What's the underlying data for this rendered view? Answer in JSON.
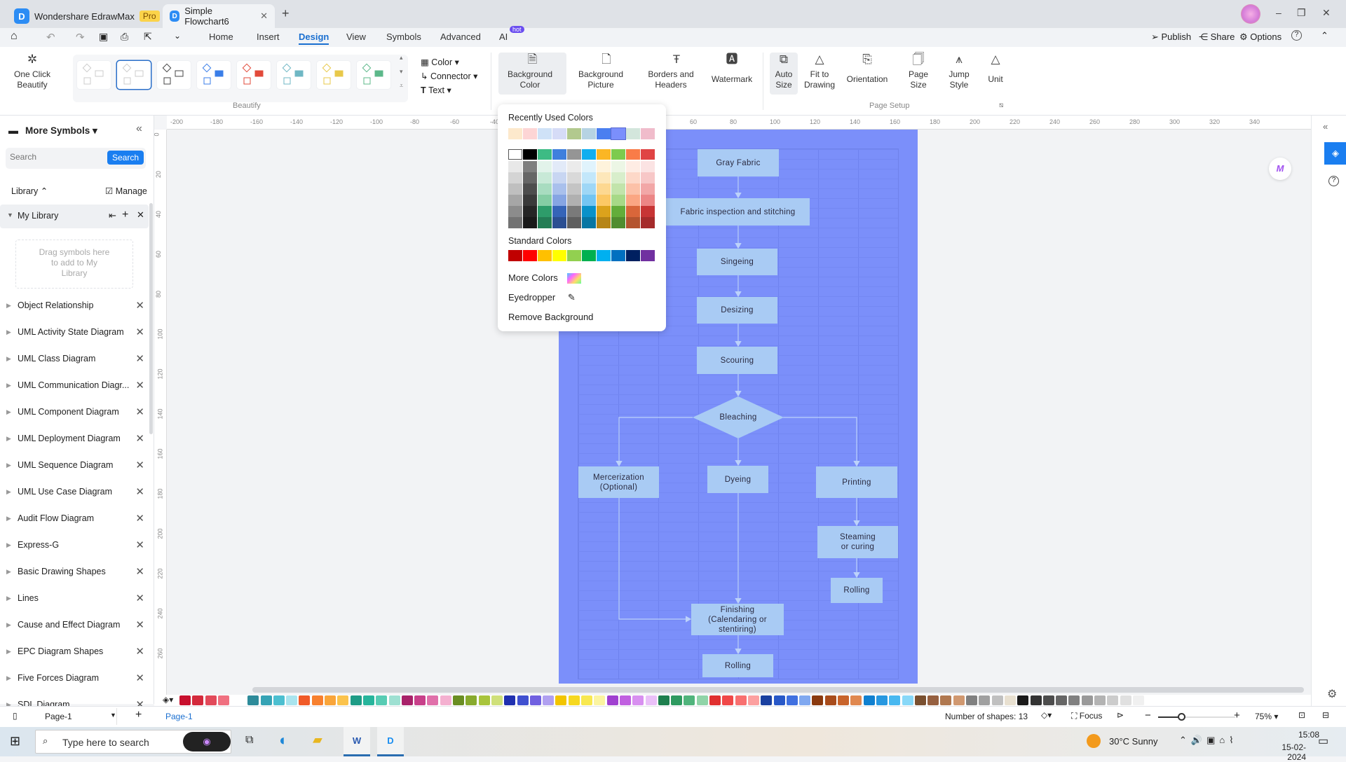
{
  "titlebar": {
    "app_name": "Wondershare EdrawMax",
    "badge": "Pro",
    "doc_tab": "Simple Flowchart6",
    "new_tab": "+",
    "min": "–",
    "max": "❐",
    "close": "✕"
  },
  "menubar": {
    "tabs": [
      "Home",
      "Insert",
      "Design",
      "View",
      "Symbols",
      "Advanced",
      "AI"
    ],
    "active": "Design",
    "ai_badge": "hot",
    "publish": "Publish",
    "share": "Share",
    "options": "Options",
    "help": "?"
  },
  "ribbon": {
    "one_click": "One Click Beautify",
    "beautify_group": "Beautify",
    "color": "Color",
    "connector": "Connector",
    "text": "Text",
    "background_color": "Background Color",
    "background_picture": "Background Picture",
    "borders_headers": "Borders and Headers",
    "watermark": "Watermark",
    "auto_size": "Auto Size",
    "fit_to_drawing": "Fit to Drawing",
    "orientation": "Orientation",
    "page_size": "Page Size",
    "jump_style": "Jump Style",
    "unit": "Unit",
    "page_setup_group": "Page Setup"
  },
  "color_dropdown": {
    "recent_title": "Recently Used Colors",
    "recent": [
      "#fde9cc",
      "#fdd5d5",
      "#cfe2f7",
      "#d6dcf7",
      "#b2c98e",
      "#b6d3e3",
      "#4a7ff0",
      "#7b8ffc",
      "#d3e6dc",
      "#f0bccb"
    ],
    "recent_selected": "#7b8ffc",
    "theme": [
      [
        "#ffffff",
        "#e8e8e8",
        "#d4d4d4",
        "#bfbfbf",
        "#a6a6a6",
        "#8c8c8c",
        "#737373"
      ],
      [
        "#000000",
        "#7f7f7f",
        "#666666",
        "#4d4d4d",
        "#3a3a3a",
        "#262626",
        "#1a1a1a"
      ],
      [
        "#3dbb84",
        "#e2f3ea",
        "#c8e9d7",
        "#a8dcc0",
        "#85cda4",
        "#2e9c6a",
        "#247d55"
      ],
      [
        "#3f7fdd",
        "#e2eaf8",
        "#c8d6f2",
        "#a9c0ec",
        "#86a5e3",
        "#3564b8",
        "#2b4f92"
      ],
      [
        "#959595",
        "#ebebeb",
        "#d9d9d9",
        "#c4c4c4",
        "#b0b0b0",
        "#7a7a7a",
        "#5f5f5f"
      ],
      [
        "#11aeef",
        "#e0f3fc",
        "#c3e7fa",
        "#9fd7f6",
        "#74c5f2",
        "#0a91c9",
        "#0876a3"
      ],
      [
        "#fbb624",
        "#fef3dc",
        "#fde7ba",
        "#fdd891",
        "#fcc865",
        "#dba21c",
        "#b68516"
      ],
      [
        "#7dcb4e",
        "#ecf6e5",
        "#d8eecb",
        "#c2e4ab",
        "#a7d987",
        "#63ad3a",
        "#508d2f"
      ],
      [
        "#f97c48",
        "#feece4",
        "#fdd8c8",
        "#fcc1a8",
        "#fba683",
        "#d9663a",
        "#b4542f"
      ],
      [
        "#e04444",
        "#fbe3e3",
        "#f7c7c7",
        "#f2a7a7",
        "#ec8686",
        "#c73535",
        "#a52b2b"
      ]
    ],
    "standard_title": "Standard Colors",
    "standard": [
      "#c00000",
      "#ff0000",
      "#ffc000",
      "#ffff00",
      "#92d050",
      "#00b050",
      "#00b0f0",
      "#0070c0",
      "#002060",
      "#7030a0"
    ],
    "more_colors": "More Colors",
    "eyedropper": "Eyedropper",
    "remove_background": "Remove Background"
  },
  "left_panel": {
    "title": "More Symbols",
    "search_placeholder": "Search",
    "search_button": "Search",
    "library": "Library",
    "manage": "Manage",
    "my_library": "My Library",
    "drop_hint": "Drag symbols here to add to My Library",
    "libraries": [
      "Object Relationship",
      "UML Activity State Diagram",
      "UML Class Diagram",
      "UML Communication Diagr...",
      "UML Component Diagram",
      "UML Deployment Diagram",
      "UML Sequence Diagram",
      "UML Use Case Diagram",
      "Audit Flow Diagram",
      "Express-G",
      "Basic Drawing Shapes",
      "Lines",
      "Cause and Effect Diagram",
      "EPC Diagram Shapes",
      "Five Forces Diagram",
      "SDL Diagram"
    ]
  },
  "rulers": {
    "top": [
      "-200",
      "-180",
      "-160",
      "-140",
      "-120",
      "-100",
      "-80",
      "-60",
      "-40",
      "-20",
      "0",
      "20",
      "40",
      "60",
      "80",
      "100",
      "120",
      "140",
      "160",
      "180",
      "200",
      "220",
      "240",
      "260",
      "280",
      "300",
      "320",
      "340"
    ],
    "left": [
      "0",
      "20",
      "40",
      "60",
      "80",
      "100",
      "120",
      "140",
      "160",
      "180",
      "200",
      "220",
      "240",
      "260"
    ]
  },
  "page": {
    "background": "#7b8ffa",
    "shape_fill": "#a9cbf4",
    "connector": "#bcd2fa"
  },
  "flowchart": {
    "gray_fabric": "Gray Fabric",
    "inspection": "Fabric inspection and stitching",
    "singeing": "Singeing",
    "desizing": "Desizing",
    "scouring": "Scouring",
    "bleaching": "Bleaching",
    "mercerization": "Mercerization (Optional)",
    "dyeing": "Dyeing",
    "printing": "Printing",
    "steaming": "Steaming or curing",
    "rolling_right": "Rolling",
    "finishing": "Finishing (Calendaring or stentiring)",
    "rolling_bottom": "Rolling"
  },
  "palette_strip": [
    "#c8102e",
    "#d42a3c",
    "#e24a5a",
    "#f07080",
    "#2e8b9a",
    "#35a3b5",
    "#4cbfd0",
    "#a9e4ee",
    "#f05a28",
    "#f7802f",
    "#f9a53a",
    "#fbc34c",
    "#1e9c86",
    "#27b59c",
    "#58ccb4",
    "#9ee0d2",
    "#a8226a",
    "#c8408a",
    "#e070aa",
    "#f4b0d0",
    "#6a8e23",
    "#88aa2e",
    "#a8c43c",
    "#cfe07a",
    "#2030b0",
    "#4050d0",
    "#7060e0",
    "#b0a0f0",
    "#f2c500",
    "#f6d820",
    "#f8e850",
    "#fbf4a0",
    "#a040d0",
    "#c060e0",
    "#d890f0",
    "#eac0f8",
    "#1e7f4e",
    "#2e9a60",
    "#50b47c",
    "#90d4a8",
    "#e03030",
    "#f04848",
    "#f87070",
    "#fca0a0",
    "#1a40a0",
    "#2858c8",
    "#4070e0",
    "#80a8f0",
    "#8a3a10",
    "#a84c1c",
    "#c8642c",
    "#e08850",
    "#1080d0",
    "#2898e0",
    "#48b8f0",
    "#88d8f8",
    "#7a5030",
    "#966040",
    "#b07850",
    "#d09870",
    "#808080",
    "#a0a0a0",
    "#c0c0c0",
    "#e8e0d0",
    "#1a1a1a",
    "#333333",
    "#4d4d4d",
    "#666666",
    "#808080",
    "#999999",
    "#b3b3b3",
    "#cccccc",
    "#e0e0e0",
    "#f0f0f0"
  ],
  "status": {
    "page_tab": "Page-1",
    "page_name": "Page-1",
    "shape_count": "Number of shapes: 13",
    "focus": "Focus",
    "zoom": "75%",
    "zoom_level": 0.3
  },
  "taskbar": {
    "search_placeholder": "Type here to search",
    "weather": "30°C  Sunny",
    "time": "15:08",
    "date": "15-02-2024"
  }
}
